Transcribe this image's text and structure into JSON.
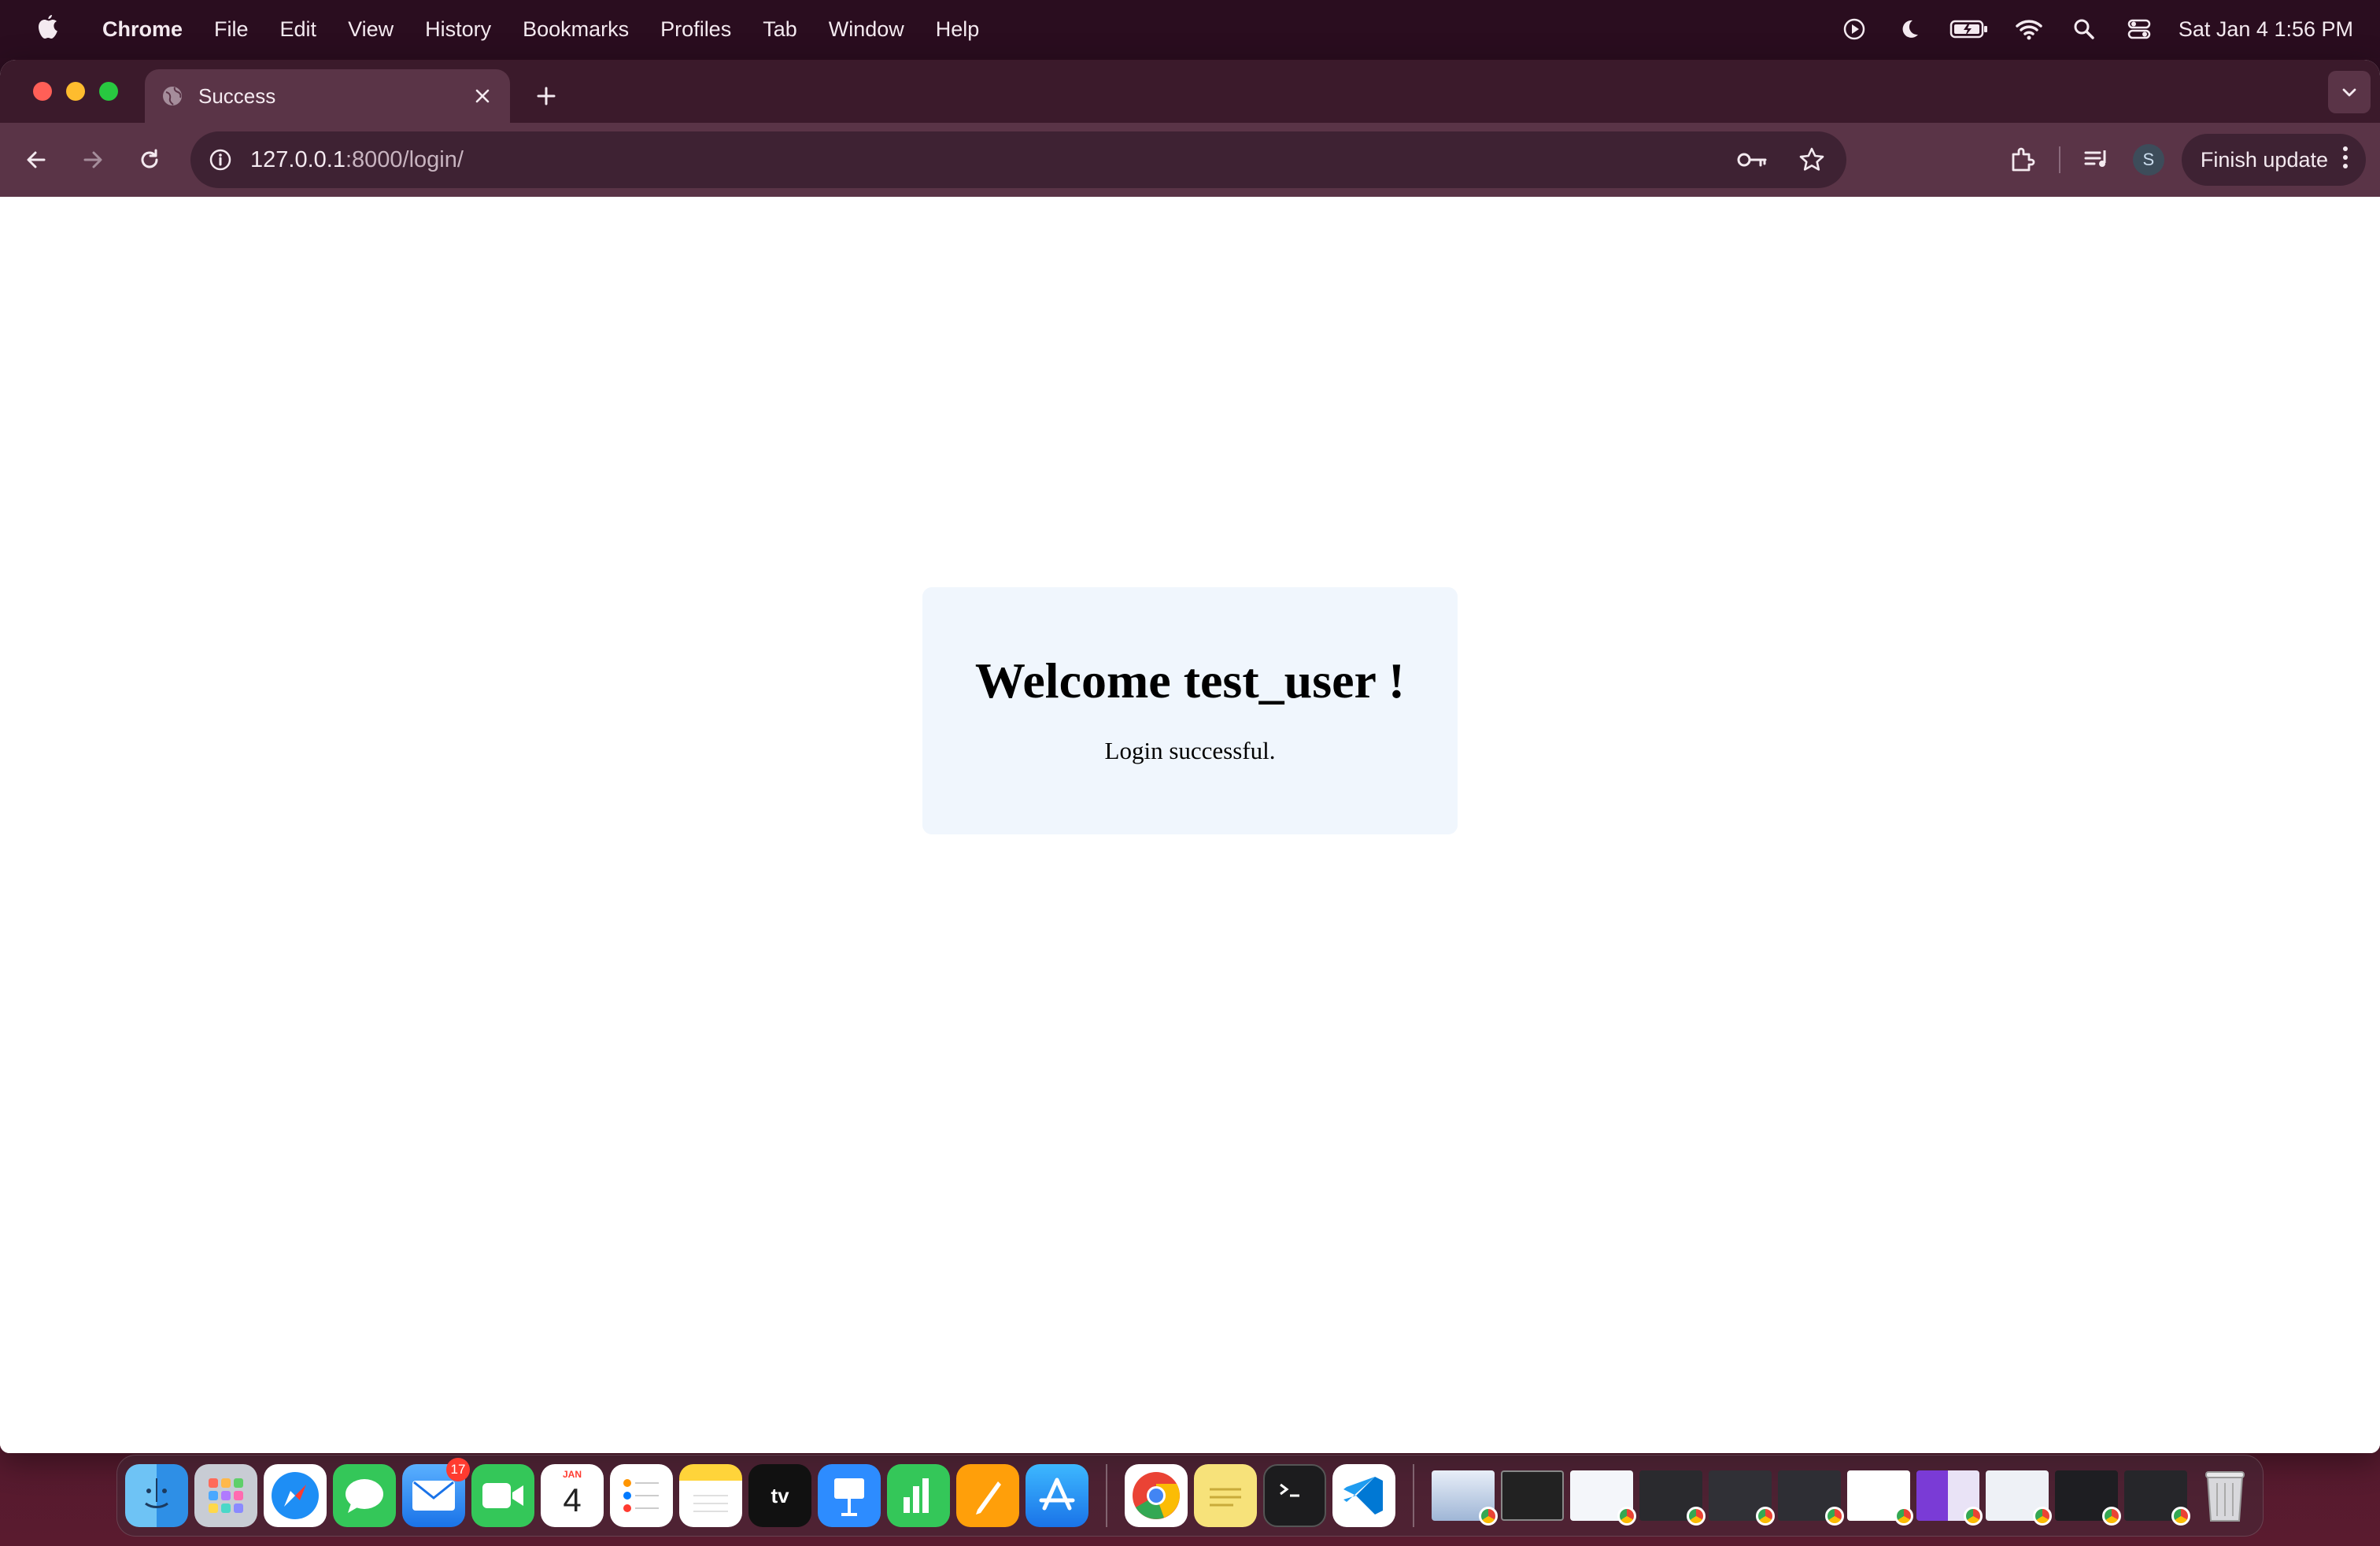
{
  "menubar": {
    "app_name": "Chrome",
    "menus": [
      "File",
      "Edit",
      "View",
      "History",
      "Bookmarks",
      "Profiles",
      "Tab",
      "Window",
      "Help"
    ],
    "clock": "Sat Jan 4  1:56 PM"
  },
  "browser": {
    "tab": {
      "title": "Success"
    },
    "address": {
      "host": "127.0.0.1",
      "path": ":8000/login/"
    },
    "avatar_initial": "S",
    "finish_update_label": "Finish update"
  },
  "page": {
    "heading": "Welcome test_user !",
    "message": "Login successful.",
    "card_bg": "#f0f6fd"
  },
  "dock": {
    "mail_badge": "17",
    "calendar_month": "JAN",
    "calendar_day": "4",
    "tv_label": "tv",
    "apps": [
      "finder-icon",
      "launchpad-icon",
      "safari-icon",
      "messages-icon",
      "mail-icon",
      "facetime-icon",
      "calendar-icon",
      "reminders-icon",
      "notes-icon",
      "apple-tv-icon",
      "keynote-icon",
      "numbers-icon",
      "pages-icon",
      "app-store-icon",
      "chrome-icon",
      "stickies-icon",
      "terminal-icon",
      "vscode-icon",
      "trash-icon"
    ]
  },
  "colors": {
    "menubar_bg": "#2a0d1f",
    "tabstrip_bg": "#3b1a2b",
    "toolbar_bg": "#5a3447",
    "omnibox_bg": "#3e2233"
  }
}
